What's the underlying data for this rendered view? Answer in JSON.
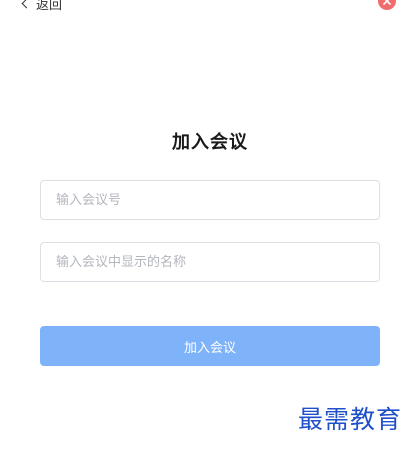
{
  "header": {
    "back_label": "返回",
    "close_icon": "close-icon",
    "close_color": "#f16c6c"
  },
  "main": {
    "title": "加入会议",
    "meeting_id_placeholder": "输入会议号",
    "meeting_id_value": "",
    "display_name_placeholder": "输入会议中显示的名称",
    "display_name_value": "",
    "join_button_label": "加入会议",
    "join_button_color": "#7fb3f9"
  },
  "watermark": {
    "text": "最需教育"
  }
}
